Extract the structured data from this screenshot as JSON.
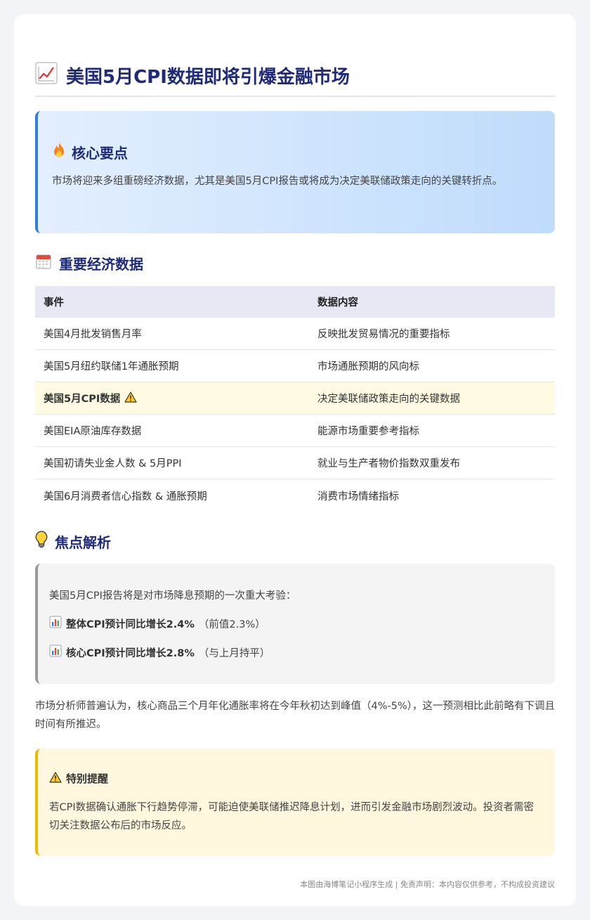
{
  "title": "美国5月CPI数据即将引爆金融市场",
  "key_points": {
    "heading": "核心要点",
    "text": "市场将迎来多组重磅经济数据，尤其是美国5月CPI报告或将成为决定美联储政策走向的关键转折点。"
  },
  "data_section": {
    "heading": "重要经济数据",
    "columns": [
      "事件",
      "数据内容"
    ],
    "rows": [
      {
        "event": "美国4月批发销售月率",
        "content": "反映批发贸易情况的重要指标"
      },
      {
        "event": "美国5月纽约联储1年通胀预期",
        "content": "市场通胀预期的风向标"
      },
      {
        "event": "美国5月CPI数据",
        "content": "决定美联储政策走向的关键数据",
        "highlight": true
      },
      {
        "event": "美国EIA原油库存数据",
        "content": "能源市场重要参考指标"
      },
      {
        "event": "美国初请失业金人数 & 5月PPI",
        "content": "就业与生产者物价指数双重发布"
      },
      {
        "event": "美国6月消费者信心指数 & 通胀预期",
        "content": "消费市场情绪指标"
      }
    ]
  },
  "focus": {
    "heading": "焦点解析",
    "intro": "美国5月CPI报告将是对市场降息预期的一次重大考验：",
    "items": [
      {
        "bold": "整体CPI预计同比增长2.4%",
        "note": "（前值2.3%）"
      },
      {
        "bold": "核心CPI预计同比增长2.8%",
        "note": "（与上月持平）"
      }
    ]
  },
  "analysis": "市场分析师普遍认为，核心商品三个月年化通胀率将在今年秋初达到峰值（4%-5%），这一预测相比此前略有下调且时间有所推迟。",
  "warning": {
    "heading": "特别提醒",
    "text": "若CPI数据确认通胀下行趋势停滞，可能迫使美联储推迟降息计划，进而引发金融市场剧烈波动。投资者需密切关注数据公布后的市场反应。"
  },
  "footer": "本图由海博笔记小程序生成 | 免责声明：本内容仅供参考，不构成投资建议",
  "colors": {
    "accent": "#1f2a7a",
    "blue_border": "#2f80d8",
    "warn_border": "#f2b700",
    "highlight_row": "#fffbe3"
  }
}
